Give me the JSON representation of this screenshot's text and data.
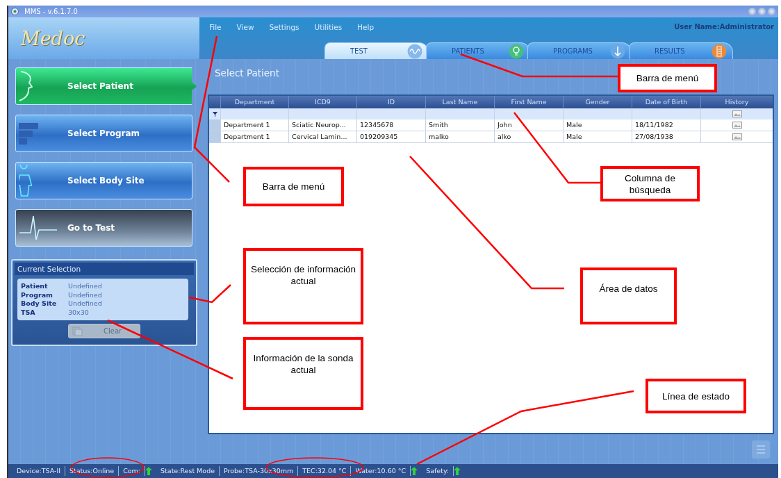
{
  "window": {
    "title": "MMS - v.6.1.7.0"
  },
  "logo": "Medoc",
  "menu": [
    "File",
    "View",
    "Settings",
    "Utilities",
    "Help"
  ],
  "user_name": "User Name:Administrator",
  "tabs": [
    {
      "label": "TEST",
      "selected": true
    },
    {
      "label": "PATIENTS",
      "selected": false
    },
    {
      "label": "PROGRAMS",
      "selected": false
    },
    {
      "label": "RESULTS",
      "selected": false
    }
  ],
  "nav_buttons": [
    {
      "label": "Select Patient",
      "selected": true,
      "disabled": false
    },
    {
      "label": "Select Program",
      "selected": false,
      "disabled": false
    },
    {
      "label": "Select Body Site",
      "selected": false,
      "disabled": false
    },
    {
      "label": "Go to Test",
      "selected": false,
      "disabled": true
    }
  ],
  "current_selection": {
    "title": "Current Selection",
    "rows": [
      {
        "label": "Patient",
        "value": "Undefined"
      },
      {
        "label": "Program",
        "value": "Undefined"
      },
      {
        "label": "Body Site",
        "value": "Undefined"
      },
      {
        "label": "TSA",
        "value": "30x30"
      }
    ],
    "clear_button": {
      "label": "Clear",
      "disabled": true
    }
  },
  "page_title": "Select Patient",
  "table": {
    "columns": [
      "Department",
      "ICD9",
      "ID",
      "Last Name",
      "First Name",
      "Gender",
      "Date of Birth",
      "History"
    ],
    "filter_row": true,
    "rows": [
      {
        "cells": [
          "Department 1",
          "Sciatic Neurop...",
          "12345678",
          "Smith",
          "John",
          "Male",
          "18/11/1982"
        ]
      },
      {
        "cells": [
          "Department 1",
          "Cervical Lamin...",
          "019209345",
          "malko",
          "alko",
          "Male",
          "27/08/1938"
        ]
      }
    ]
  },
  "status_bar": [
    {
      "kind": "text",
      "text": "Device:TSA-II"
    },
    {
      "kind": "text",
      "text": "Status:Online"
    },
    {
      "kind": "text",
      "text": "Com:"
    },
    {
      "kind": "led"
    },
    {
      "kind": "text",
      "text": "State:Rest Mode"
    },
    {
      "kind": "text",
      "text": "Probe:TSA-30x30mm"
    },
    {
      "kind": "text",
      "text": "TEC:32.04 °C"
    },
    {
      "kind": "text",
      "text": "Water:10.60 °C"
    },
    {
      "kind": "led"
    },
    {
      "kind": "text",
      "text": "Safety:"
    },
    {
      "kind": "led"
    }
  ],
  "annotations": [
    {
      "text": "Barra de menú"
    },
    {
      "text": "Barra de menú"
    },
    {
      "text": "Columna de búsqueda"
    },
    {
      "text": "Selección de información actual"
    },
    {
      "text": "Área de datos"
    },
    {
      "text": "Información de la sonda actual"
    },
    {
      "text": "Línea de estado"
    }
  ]
}
